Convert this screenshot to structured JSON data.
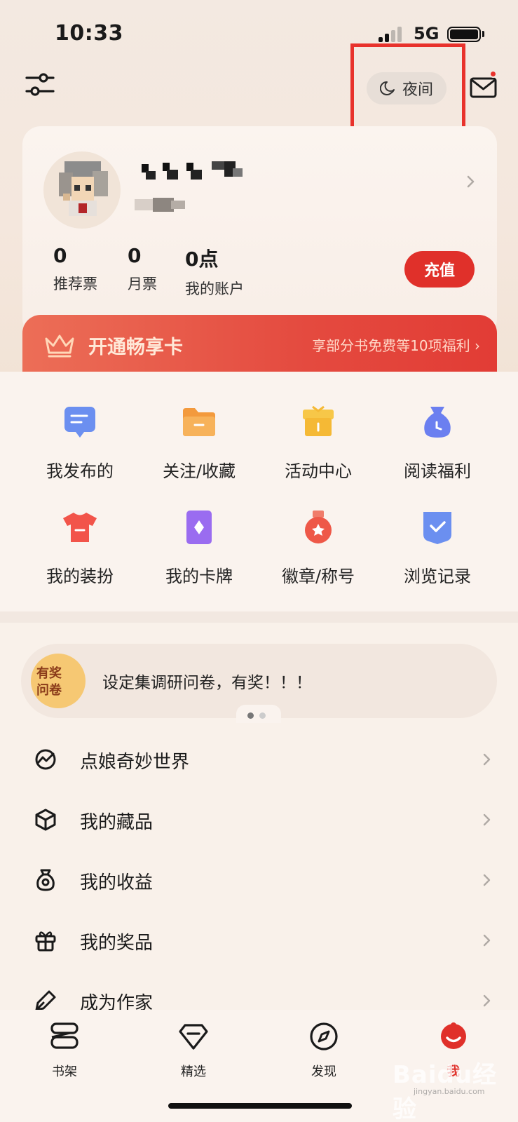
{
  "status_bar": {
    "time": "10:33",
    "network": "5G"
  },
  "header": {
    "night_mode_label": "夜间",
    "mail_has_notification": true,
    "highlight_color": "#e8322c"
  },
  "profile": {
    "stats": [
      {
        "value": "0",
        "label": "推荐票"
      },
      {
        "value": "0",
        "label": "月票"
      },
      {
        "value": "0点",
        "label": "我的账户"
      }
    ],
    "recharge_label": "充值"
  },
  "vip_banner": {
    "title": "开通畅享卡",
    "description": "享部分书免费等10项福利"
  },
  "grid": [
    {
      "label": "我发布的",
      "icon": "message-icon",
      "color": "#6b8ff0"
    },
    {
      "label": "关注/收藏",
      "icon": "folder-icon",
      "color": "#f39a3d"
    },
    {
      "label": "活动中心",
      "icon": "gift-box-icon",
      "color": "#f5b935"
    },
    {
      "label": "阅读福利",
      "icon": "money-bag-icon",
      "color": "#6b7ff0"
    },
    {
      "label": "我的装扮",
      "icon": "tshirt-icon",
      "color": "#f2544a"
    },
    {
      "label": "我的卡牌",
      "icon": "card-icon",
      "color": "#9a6cf0"
    },
    {
      "label": "徽章/称号",
      "icon": "medal-icon",
      "color": "#ee5848"
    },
    {
      "label": "浏览记录",
      "icon": "history-shield-icon",
      "color": "#6b8ff0"
    }
  ],
  "survey": {
    "badge_line1": "有奖",
    "badge_line2": "问卷",
    "text": "设定集调研问卷，有奖！！！"
  },
  "menu": [
    {
      "label": "点娘奇妙世界",
      "icon": "world-icon"
    },
    {
      "label": "我的藏品",
      "icon": "cube-icon"
    },
    {
      "label": "我的收益",
      "icon": "earnings-bag-icon"
    },
    {
      "label": "我的奖品",
      "icon": "prize-gift-icon"
    },
    {
      "label": "成为作家",
      "icon": "pen-icon"
    }
  ],
  "tabs": [
    {
      "label": "书架",
      "icon": "bookshelf-icon",
      "active": false
    },
    {
      "label": "精选",
      "icon": "diamond-icon",
      "active": false
    },
    {
      "label": "发现",
      "icon": "compass-icon",
      "active": false
    },
    {
      "label": "我",
      "icon": "profile-icon",
      "active": true
    }
  ],
  "colors": {
    "accent": "#e0302a",
    "background": "#f9f1ea"
  },
  "watermark": {
    "text": "Baidu经验",
    "sub": "jingyan.baidu.com"
  }
}
